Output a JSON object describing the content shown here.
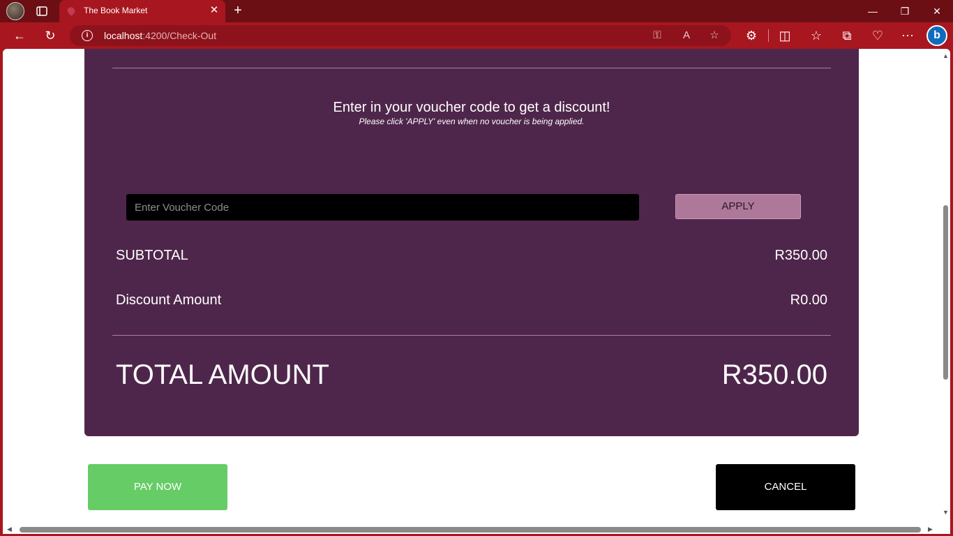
{
  "browser": {
    "tab_title": "The Book Market",
    "url_host": "localhost",
    "url_path": ":4200/Check-Out",
    "accent": "#a8161f"
  },
  "checkout": {
    "heading": "Enter in your voucher code to get a discount!",
    "subheading": "Please click 'APPLY' even when no voucher is being applied.",
    "voucher_placeholder": "Enter Voucher Code",
    "voucher_value": "",
    "apply_label": "APPLY",
    "subtotal_label": "SUBTOTAL",
    "subtotal_value": "R350.00",
    "discount_label": "Discount Amount",
    "discount_value": "R0.00",
    "total_label": "TOTAL AMOUNT",
    "total_value": "R350.00",
    "card_color": "#4f264b"
  },
  "actions": {
    "pay_label": "PAY NOW",
    "pay_color": "#66cc66",
    "cancel_label": "CANCEL"
  }
}
